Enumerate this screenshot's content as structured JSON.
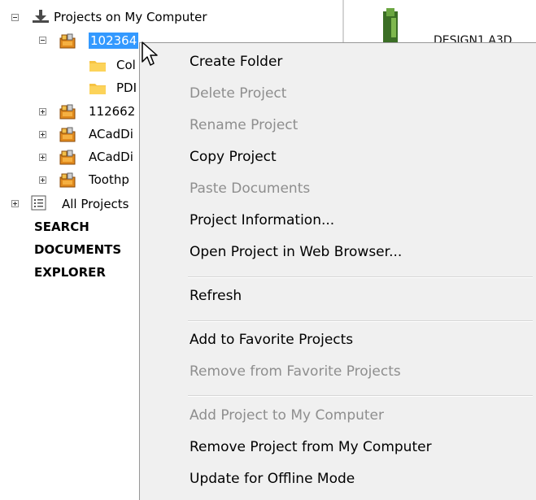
{
  "tree": {
    "root_label": "Projects on My Computer",
    "projects": [
      {
        "label": "102364",
        "expanded": true,
        "selected": true,
        "children": [
          "Col",
          "PDI"
        ]
      },
      {
        "label": "112662"
      },
      {
        "label": "ACadDi"
      },
      {
        "label": "ACadDi"
      },
      {
        "label": "Toothp"
      }
    ],
    "all_projects_label": "All Projects",
    "search_lines": [
      "SEARCH",
      "DOCUMENTS",
      "EXPLORER"
    ]
  },
  "right_pane": {
    "design_label": "DESIGN1.A3D"
  },
  "context_menu": {
    "groups": [
      [
        {
          "label": "Create Folder",
          "enabled": true
        },
        {
          "label": "Delete Project",
          "enabled": false
        },
        {
          "label": "Rename Project",
          "enabled": false
        },
        {
          "label": "Copy Project",
          "enabled": true
        },
        {
          "label": "Paste Documents",
          "enabled": false
        },
        {
          "label": "Project Information...",
          "enabled": true
        },
        {
          "label": "Open Project in Web Browser...",
          "enabled": true
        }
      ],
      [
        {
          "label": "Refresh",
          "enabled": true
        }
      ],
      [
        {
          "label": "Add to Favorite Projects",
          "enabled": true
        },
        {
          "label": "Remove from Favorite Projects",
          "enabled": false
        }
      ],
      [
        {
          "label": "Add Project to My Computer",
          "enabled": false
        },
        {
          "label": "Remove Project from My Computer",
          "enabled": true
        },
        {
          "label": "Update for Offline Mode",
          "enabled": true
        }
      ]
    ]
  },
  "colors": {
    "selection": "#3399ff",
    "menu_background": "#f0f0f0",
    "disabled_text": "#8e8e8e",
    "folder_yellow": "#f6c343",
    "project_orange": "#e08a1e"
  }
}
